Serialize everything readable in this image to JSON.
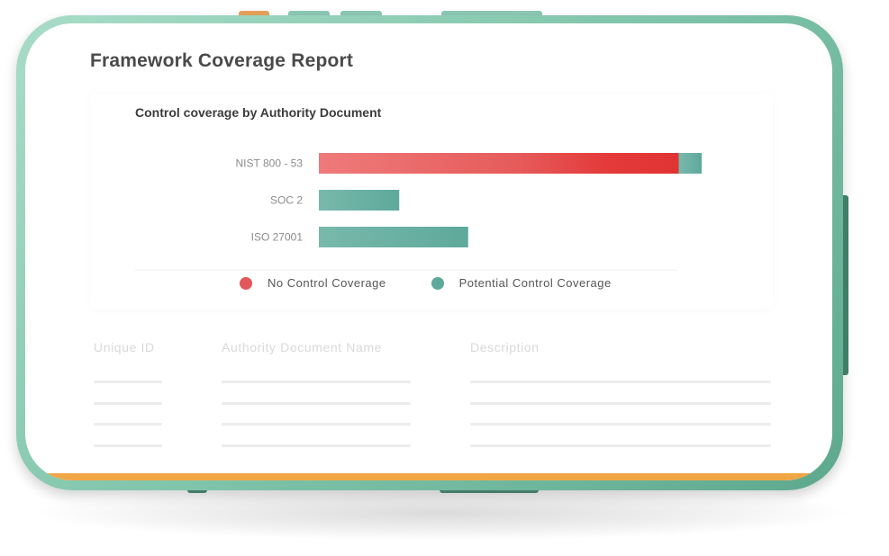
{
  "report": {
    "title": "Framework Coverage Report"
  },
  "chart_data": {
    "type": "bar",
    "orientation": "horizontal",
    "stacked": true,
    "title": "Control coverage by Authority Document",
    "categories": [
      "NIST 800 - 53",
      "SOC 2",
      "ISO 27001"
    ],
    "series": [
      {
        "name": "No Control Coverage",
        "values": [
          94,
          0,
          0
        ],
        "color": "#e3474a"
      },
      {
        "name": "Potential Control Coverage",
        "values": [
          6,
          21,
          39
        ],
        "color": "#5ea99b"
      }
    ],
    "xlim": [
      0,
      100
    ],
    "grid": false,
    "legend": "bottom"
  },
  "table": {
    "headers": [
      "Unique ID",
      "Authority Document Name",
      "Description"
    ],
    "placeholder_rows": 4
  },
  "colors": {
    "device_frame": "#7fc4aa",
    "accent_bar": "#f1a646",
    "title_text": "#4a4a4a"
  }
}
